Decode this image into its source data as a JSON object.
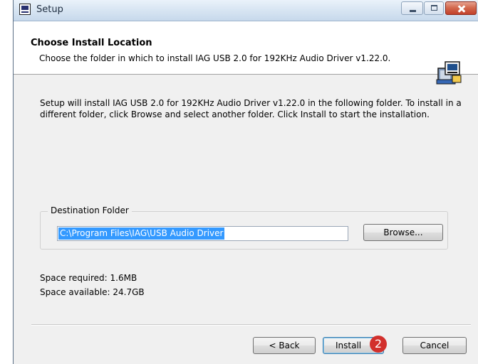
{
  "window": {
    "title": "Setup"
  },
  "header": {
    "title": "Choose Install Location",
    "subtitle": "Choose the folder in which to install IAG USB 2.0 for 192KHz Audio Driver v1.22.0."
  },
  "body": {
    "instructions": "Setup will install IAG USB 2.0 for 192KHz Audio Driver v1.22.0 in the following folder. To install in a different folder, click Browse and select another folder. Click Install to start the installation."
  },
  "destination": {
    "legend": "Destination Folder",
    "path": "C:\\Program Files\\IAG\\USB Audio Driver",
    "browse_label": "Browse..."
  },
  "space": {
    "required": "Space required: 1.6MB",
    "available": "Space available: 24.7GB"
  },
  "buttons": {
    "back": "< Back",
    "install": "Install",
    "cancel": "Cancel"
  },
  "annotation": {
    "step": "2",
    "color": "#d2302c"
  },
  "icons": [
    "app-icon",
    "minimize-icon",
    "maximize-icon",
    "close-icon",
    "installer-icon"
  ]
}
